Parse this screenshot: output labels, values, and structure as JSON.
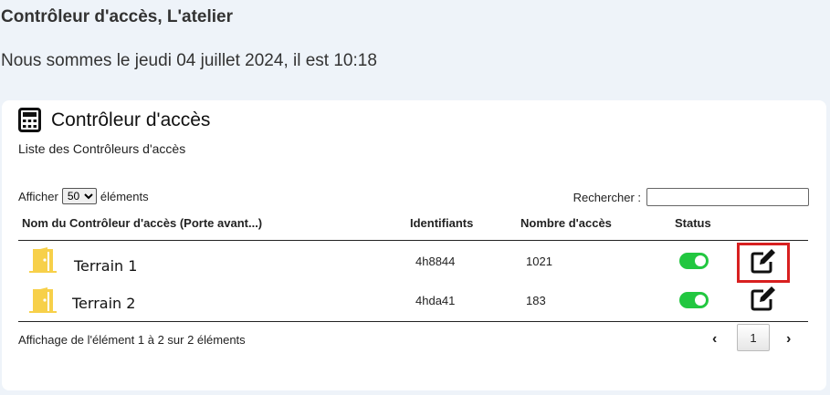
{
  "page": {
    "title": "Contrôleur d'accès, L'atelier",
    "date_line": "Nous sommes le jeudi 04 juillet 2024, il est 10:18"
  },
  "card": {
    "icon": "calculator-icon",
    "title": "Contrôleur d'accès",
    "subtitle": "Liste des Contrôleurs d'accès"
  },
  "table_controls": {
    "length_prefix": "Afficher",
    "length_value": "50",
    "length_suffix": "éléments",
    "search_label": "Rechercher :",
    "search_value": ""
  },
  "table": {
    "columns": [
      "Nom du Contrôleur d'accès (Porte avant...)",
      "Identifiants",
      "Nombre d'accès",
      "Status"
    ],
    "rows": [
      {
        "icon": "door-open-icon",
        "name": "Terrain 1",
        "identifiant": "4h8844",
        "acces": "1021",
        "status": "on"
      },
      {
        "icon": "door-open-icon",
        "name": "Terrain 2",
        "identifiant": "4hda41",
        "acces": "183",
        "status": "on"
      }
    ]
  },
  "footer": {
    "info": "Affichage de l'élément 1 à 2 sur 2 éléments",
    "prev_icon": "chevron-left-icon",
    "next_icon": "chevron-right-icon",
    "prev_glyph": "‹",
    "next_glyph": "›",
    "current_page": "1"
  },
  "colors": {
    "background": "#eef3f9",
    "door": "#f7d04a",
    "toggle_on": "#22c740",
    "highlight": "#d82020"
  }
}
